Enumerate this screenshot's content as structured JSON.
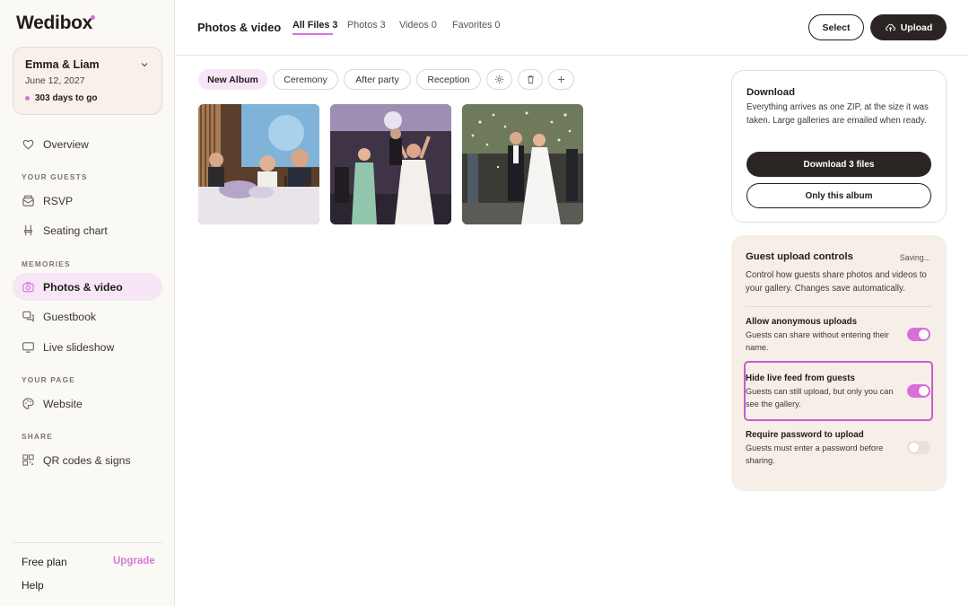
{
  "brand": {
    "name": "Wedibox"
  },
  "event": {
    "name": "Emma & Liam",
    "date": "June 12, 2027",
    "countdown": "303 days to go"
  },
  "sidebar": {
    "items": [
      {
        "label": "Overview",
        "icon": "heart-icon"
      },
      {
        "label": "RSVP",
        "icon": "envelope-icon"
      },
      {
        "label": "Seating chart",
        "icon": "chair-icon"
      },
      {
        "label": "Photos & video",
        "icon": "camera-icon",
        "active": true
      },
      {
        "label": "Guestbook",
        "icon": "chat-icon"
      },
      {
        "label": "Live slideshow",
        "icon": "monitor-icon"
      },
      {
        "label": "Website",
        "icon": "palette-icon"
      },
      {
        "label": "QR codes & signs",
        "icon": "qr-code-icon"
      }
    ],
    "sections": [
      "YOUR GUESTS",
      "MEMORIES",
      "YOUR PAGE",
      "SHARE"
    ],
    "plan": "Free plan",
    "upgrade": "Upgrade",
    "help": "Help"
  },
  "header": {
    "title": "Photos & video",
    "tabs": [
      {
        "label": "All Files 3",
        "active": true
      },
      {
        "label": "Photos 3"
      },
      {
        "label": "Videos 0"
      },
      {
        "label": "Favorites 0"
      }
    ],
    "select_label": "Select",
    "upload_label": "Upload"
  },
  "albums": {
    "chips": [
      "New Album",
      "Ceremony",
      "After party",
      "Reception"
    ],
    "tools": [
      "settings-icon",
      "trash-icon",
      "plus-icon"
    ]
  },
  "photos": [
    {
      "scene": "reception-head-table"
    },
    {
      "scene": "dance-floor"
    },
    {
      "scene": "confetti-exit"
    }
  ],
  "download": {
    "title": "Download",
    "description": "Everything arrives as one ZIP, at the size it was taken. Large galleries are emailed when ready.",
    "primary": "Download 3 files",
    "secondary": "Only this album"
  },
  "guest_controls": {
    "title": "Guest upload controls",
    "status": "Saving...",
    "description": "Control how guests share photos and videos to your gallery. Changes save automatically.",
    "settings": [
      {
        "title": "Allow anonymous uploads",
        "description": "Guests can share without entering their name.",
        "on": true
      },
      {
        "title": "Hide live feed from guests",
        "description": "Guests can still upload, but only you can see the gallery.",
        "on": true
      },
      {
        "title": "Require password to upload",
        "description": "Guests must enter a password before sharing.",
        "on": false
      }
    ]
  },
  "colors": {
    "accent": "#d86fdc",
    "dark": "#2a2523",
    "cream": "#f5efe7"
  }
}
